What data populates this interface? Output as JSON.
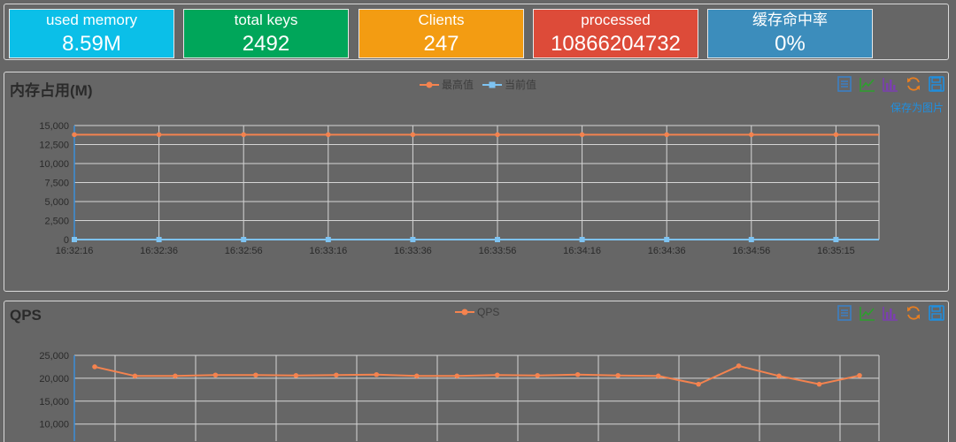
{
  "stats": [
    {
      "label": "used memory",
      "value": "8.59M",
      "color": "#0bbfe8"
    },
    {
      "label": "total keys",
      "value": "2492",
      "color": "#00a65a"
    },
    {
      "label": "Clients",
      "value": "247",
      "color": "#f39c12"
    },
    {
      "label": "processed",
      "value": "10866204732",
      "color": "#dd4b39"
    },
    {
      "label": "缓存命中率",
      "value": "0%",
      "color": "#3c8dbc"
    }
  ],
  "memory_panel": {
    "title": "内存占用(M)",
    "legend": [
      {
        "name": "最高值",
        "color": "#f4834f"
      },
      {
        "name": "当前值",
        "color": "#7ec3f2"
      }
    ],
    "save_label": "保存为图片"
  },
  "qps_panel": {
    "title": "QPS",
    "legend": [
      {
        "name": "QPS",
        "color": "#f4834f"
      }
    ]
  },
  "toolbox_icons": [
    "data-view-icon",
    "line-chart-icon",
    "bar-chart-icon",
    "restore-icon",
    "save-image-icon"
  ],
  "chart_data": [
    {
      "type": "line",
      "x": [
        "16:32:16",
        "16:32:36",
        "16:32:56",
        "16:33:16",
        "16:33:36",
        "16:33:56",
        "16:34:16",
        "16:34:36",
        "16:34:56",
        "16:35:15"
      ],
      "series": [
        {
          "name": "最高值",
          "values": [
            13800,
            13800,
            13800,
            13800,
            13800,
            13800,
            13800,
            13800,
            13800,
            13800
          ]
        },
        {
          "name": "当前值",
          "values": [
            0,
            0,
            0,
            0,
            0,
            0,
            0,
            0,
            0,
            0
          ]
        }
      ],
      "ylim": [
        0,
        15000
      ],
      "yticks": [
        "0",
        "2,500",
        "5,000",
        "7,500",
        "10,000",
        "12,500",
        "15,000"
      ],
      "grid": true,
      "legend_position": "top-center"
    },
    {
      "type": "line",
      "series": [
        {
          "name": "QPS",
          "values": [
            22500,
            20500,
            20500,
            20700,
            20700,
            20600,
            20700,
            20800,
            20500,
            20500,
            20700,
            20600,
            20800,
            20600,
            20500,
            18700,
            22700,
            20500,
            18700,
            20600
          ]
        }
      ],
      "ylim": [
        0,
        25000
      ],
      "yticks": [
        "10,000",
        "15,000",
        "20,000",
        "25,000"
      ],
      "grid": true,
      "legend_position": "top-center"
    }
  ]
}
